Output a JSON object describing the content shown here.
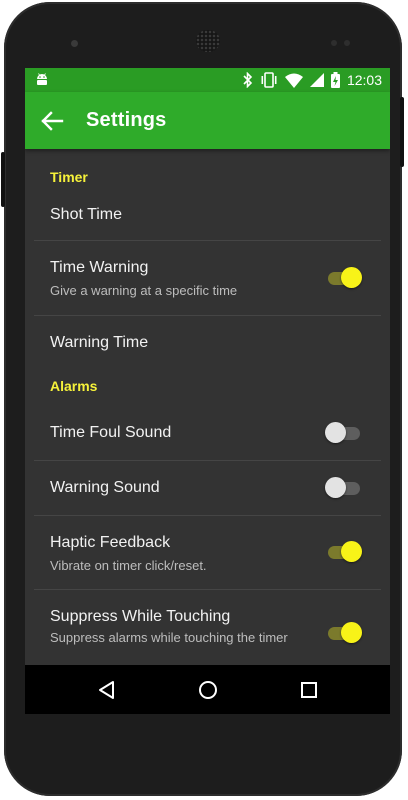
{
  "status_bar": {
    "time": "12:03",
    "icons": [
      "android-icon",
      "bluetooth-icon",
      "vibrate-icon",
      "wifi-icon",
      "signal-icon",
      "battery-charging-icon"
    ]
  },
  "app_bar": {
    "title": "Settings",
    "back_icon": "arrow-back-icon"
  },
  "settings": {
    "categories": {
      "timer": "Timer",
      "alarms": "Alarms"
    },
    "shot_time": {
      "title": "Shot Time"
    },
    "time_warning": {
      "title": "Time Warning",
      "summary": "Give a warning at a specific time",
      "enabled": true
    },
    "warning_time": {
      "title": "Warning Time"
    },
    "time_foul_sound": {
      "title": "Time Foul Sound",
      "enabled": false
    },
    "warning_sound": {
      "title": "Warning Sound",
      "enabled": false
    },
    "haptic_feedback": {
      "title": "Haptic Feedback",
      "summary": "Vibrate on timer click/reset.",
      "enabled": true
    },
    "suppress_while_touching": {
      "title": "Suppress While Touching",
      "summary": "Suppress alarms while touching the timer",
      "enabled": true
    }
  },
  "nav_bar": {
    "icons": [
      "back-triangle-icon",
      "home-circle-icon",
      "recents-square-icon"
    ]
  },
  "colors": {
    "primary": "#2fab2a",
    "primary_dark": "#2a9c24",
    "accent": "#f8f318",
    "background": "#333333"
  }
}
